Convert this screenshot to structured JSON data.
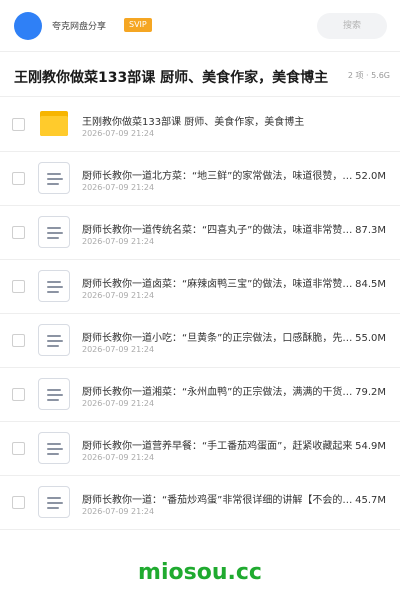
{
  "header": {
    "owner_name": "夸克网盘分享",
    "badge": "SVIP",
    "search_placeholder": "搜索"
  },
  "share": {
    "title": "王刚教你做菜133部课 厨师、美食作家，美食博主",
    "summary": "2 项 · 5.6G"
  },
  "files": [
    {
      "type": "folder",
      "name": "王刚教你做菜133部课 厨师、美食作家，美食博主",
      "date": "2026-07-09 21:24",
      "size": ""
    },
    {
      "type": "file",
      "name": "厨师长教你一道北方菜：“地三鲜”的家常做法，味道很赞，先收藏了",
      "date": "2026-07-09 21:24",
      "size": "52.0M"
    },
    {
      "type": "file",
      "name": "厨师长教你一道传统名菜：“四喜丸子”的做法，味道非常赞，先收藏了",
      "date": "2026-07-09 21:24",
      "size": "87.3M"
    },
    {
      "type": "file",
      "name": "厨师长教你一道卤菜：“麻辣卤鸭三宝”的做法，味道非常赞，先收藏了",
      "date": "2026-07-09 21:24",
      "size": "84.5M"
    },
    {
      "type": "file",
      "name": "厨师长教你一道小吃：“旦黄条”的正宗做法，口感酥脆，先收藏了",
      "date": "2026-07-09 21:24",
      "size": "55.0M"
    },
    {
      "type": "file",
      "name": "厨师长教你一道湘菜：“永州血鸭”的正宗做法，满满的干货，先收藏了",
      "date": "2026-07-09 21:24",
      "size": "79.2M"
    },
    {
      "type": "file",
      "name": "厨师长教你一道营养早餐：“手工番茄鸡蛋面”，赶紧收藏起来",
      "date": "2026-07-09 21:24",
      "size": "54.9M"
    },
    {
      "type": "file",
      "name": "厨师长教你一道：“番茄炒鸡蛋”非常很详细的讲解【不会的快来学】",
      "date": "2026-07-09 21:24",
      "size": "45.7M"
    }
  ],
  "footer": {
    "watermark": "miosou.cc"
  }
}
